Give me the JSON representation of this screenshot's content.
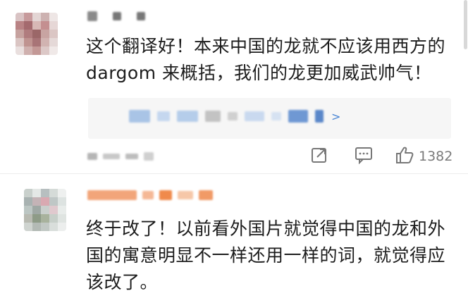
{
  "comments": [
    {
      "text_line1": "这个翻译好！本来中国的龙就不应该用西方的",
      "text_line2": "dargom 来概括，我们的龙更加威武帅气！",
      "quote_arrow": ">",
      "actions": {
        "like_count": "1382"
      }
    },
    {
      "text_line1": "终于改了！以前看外国片就觉得中国的龙和外",
      "text_line2": "国的寓意明显不一样还用一样的词，就觉得应",
      "text_line3": "该改了。"
    }
  ],
  "icons": [
    "share-icon",
    "comment-icon",
    "like-icon"
  ],
  "colors": {
    "link_blue": "#4a86d4",
    "muted_gray": "#7a7a7a",
    "quote_bg": "#f6f6f6",
    "username_orange": "#f08a4b"
  }
}
